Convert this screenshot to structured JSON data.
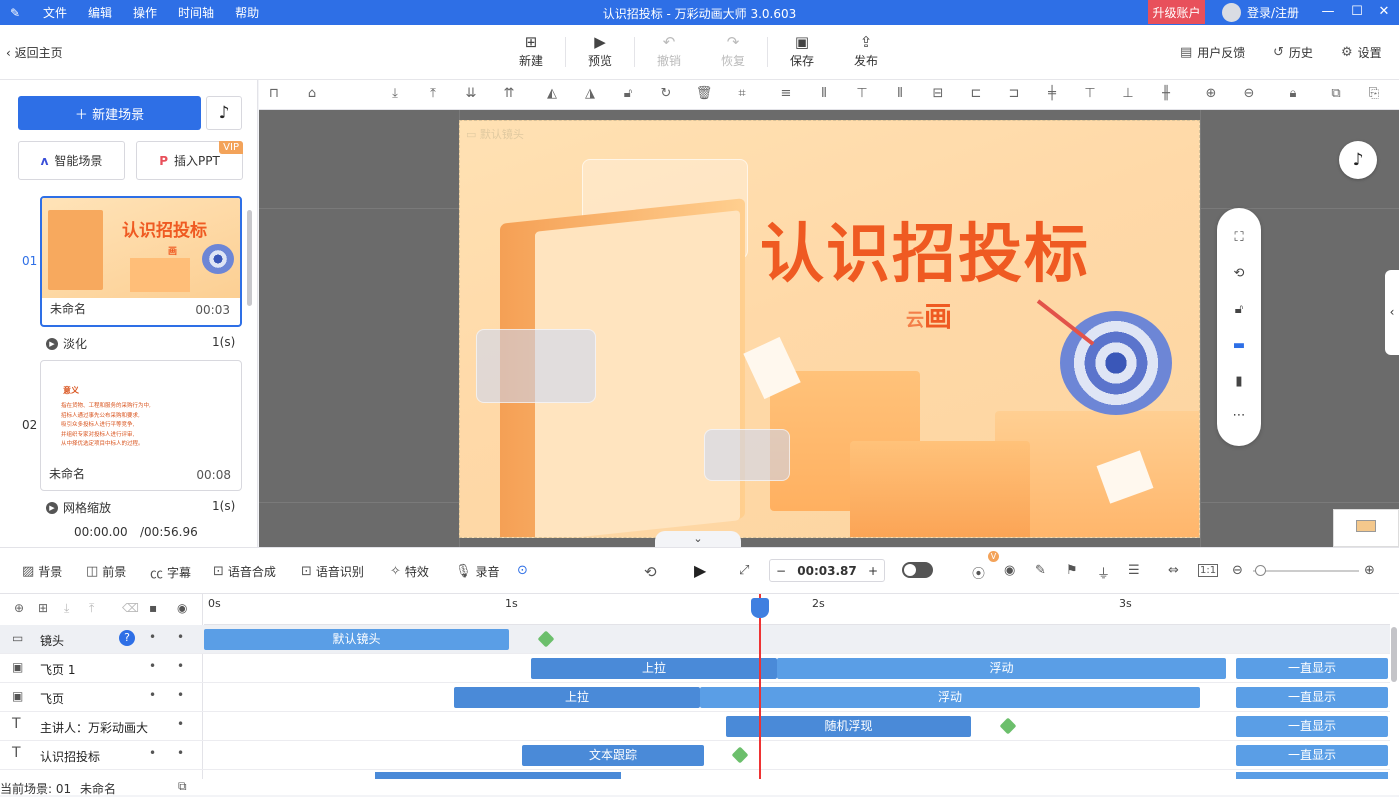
{
  "titlebar": {
    "menu": [
      "文件",
      "编辑",
      "操作",
      "时间轴",
      "帮助"
    ],
    "title": "认识招投标 - 万彩动画大师 3.0.603",
    "upgrade": "升级账户",
    "login": "登录/注册",
    "colors": {
      "bar": "#2e6fe6",
      "upgrade": "#e8505b"
    }
  },
  "toolbar": {
    "back": "返回主页",
    "new": "新建",
    "preview": "预览",
    "undo": "撤销",
    "redo": "恢复",
    "save": "保存",
    "publish": "发布",
    "feedback": "用户反馈",
    "history": "历史",
    "settings": "设置"
  },
  "left": {
    "new_scene": "新建场景",
    "smart_scene": "智能场景",
    "insert_ppt": "插入PPT",
    "vip": "VIP",
    "scenes": [
      {
        "num": "01",
        "name": "未命名",
        "duration": "00:03",
        "thumb_title": "认识招投标",
        "thumb_sub": "画",
        "transition": "淡化",
        "transition_time": "1(s)"
      },
      {
        "num": "02",
        "name": "未命名",
        "duration": "00:08",
        "thumb_title": "意义",
        "thumb_lines": [
          "指在货物、工程和服务的采购行为中,",
          "招标人通过事先公布采购和要求,",
          "吸引众多投标人进行平等竞争,",
          "并组织专家对投标人进行评审,",
          "从中择优选定项目中标人的过程。"
        ],
        "transition": "网格缩放",
        "transition_time": "1(s)"
      }
    ],
    "time_current": "00:00.00",
    "time_total": "/00:56.96"
  },
  "canvas": {
    "camera_label": "默认镜头",
    "stage_title": "认识招投标",
    "stage_sub": "画",
    "stage_sub_prefix": "云"
  },
  "timeline_tools": {
    "bg": "背景",
    "fg": "前景",
    "subtitle": "字幕",
    "tts": "语音合成",
    "asr": "语音识别",
    "fx": "特效",
    "record": "录音",
    "time": "00:03.87",
    "v_badge": "V",
    "ratio": "1:1"
  },
  "timeline": {
    "ruler": [
      "0s",
      "1s",
      "2s",
      "3s"
    ],
    "rows": [
      {
        "name": "镜头",
        "clips": [
          "默认镜头"
        ]
      },
      {
        "name": "飞页 1",
        "clips": [
          "上拉",
          "浮动",
          "一直显示"
        ]
      },
      {
        "name": "飞页",
        "clips": [
          "上拉",
          "浮动",
          "一直显示"
        ]
      },
      {
        "name": "主讲人：万彩动画大",
        "clips": [
          "随机浮现",
          "一直显示"
        ]
      },
      {
        "name": "认识招投标",
        "clips": [
          "文本跟踪",
          "一直显示"
        ]
      }
    ]
  },
  "status": {
    "scene": "当前场景: 01",
    "scene_name": "未命名"
  }
}
